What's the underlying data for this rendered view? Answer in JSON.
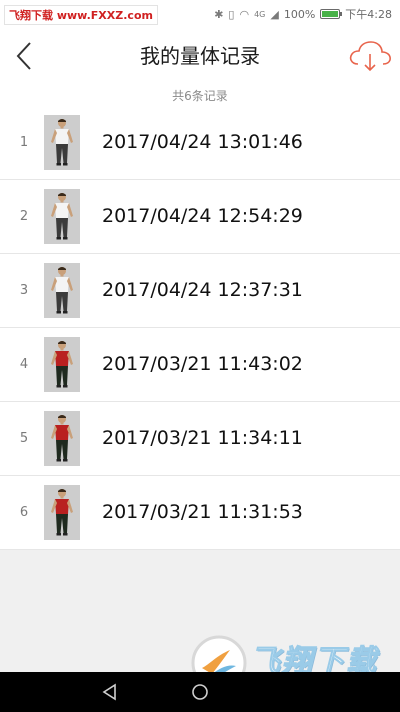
{
  "status_bar": {
    "source_label": "飞翔下载 www.FXXZ.com",
    "icons": [
      "bluetooth-icon",
      "vibrate-icon",
      "wifi-icon",
      "signal-icon"
    ],
    "network": "4G",
    "battery_percent": "100%",
    "battery_level": 1.0,
    "battery_color": "#48b248",
    "time": "下午4:28"
  },
  "header": {
    "title": "我的量体记录",
    "back_icon": "chevron-left-icon",
    "cloud_icon": "cloud-download-icon",
    "accent_color": "#e8644c"
  },
  "summary": {
    "count_text": "共6条记录"
  },
  "records": [
    {
      "index": "1",
      "datetime": "2017/04/24 13:01:46",
      "thumb_outfit": "white"
    },
    {
      "index": "2",
      "datetime": "2017/04/24 12:54:29",
      "thumb_outfit": "white"
    },
    {
      "index": "3",
      "datetime": "2017/04/24 12:37:31",
      "thumb_outfit": "white"
    },
    {
      "index": "4",
      "datetime": "2017/03/21 11:43:02",
      "thumb_outfit": "red"
    },
    {
      "index": "5",
      "datetime": "2017/03/21 11:34:11",
      "thumb_outfit": "red"
    },
    {
      "index": "6",
      "datetime": "2017/03/21 11:31:53",
      "thumb_outfit": "red"
    }
  ],
  "watermark": {
    "text": "飞翔下载",
    "url": "www.FXXZ.com"
  }
}
